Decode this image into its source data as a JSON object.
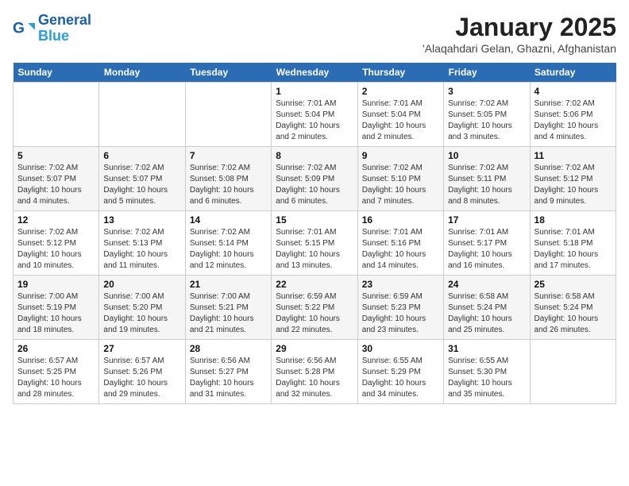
{
  "header": {
    "logo_line1": "General",
    "logo_line2": "Blue",
    "title": "January 2025",
    "subtitle": "'Alaqahdari Gelan, Ghazni, Afghanistan"
  },
  "days_of_week": [
    "Sunday",
    "Monday",
    "Tuesday",
    "Wednesday",
    "Thursday",
    "Friday",
    "Saturday"
  ],
  "weeks": [
    [
      {
        "num": "",
        "info": ""
      },
      {
        "num": "",
        "info": ""
      },
      {
        "num": "",
        "info": ""
      },
      {
        "num": "1",
        "info": "Sunrise: 7:01 AM\nSunset: 5:04 PM\nDaylight: 10 hours\nand 2 minutes."
      },
      {
        "num": "2",
        "info": "Sunrise: 7:01 AM\nSunset: 5:04 PM\nDaylight: 10 hours\nand 2 minutes."
      },
      {
        "num": "3",
        "info": "Sunrise: 7:02 AM\nSunset: 5:05 PM\nDaylight: 10 hours\nand 3 minutes."
      },
      {
        "num": "4",
        "info": "Sunrise: 7:02 AM\nSunset: 5:06 PM\nDaylight: 10 hours\nand 4 minutes."
      }
    ],
    [
      {
        "num": "5",
        "info": "Sunrise: 7:02 AM\nSunset: 5:07 PM\nDaylight: 10 hours\nand 4 minutes."
      },
      {
        "num": "6",
        "info": "Sunrise: 7:02 AM\nSunset: 5:07 PM\nDaylight: 10 hours\nand 5 minutes."
      },
      {
        "num": "7",
        "info": "Sunrise: 7:02 AM\nSunset: 5:08 PM\nDaylight: 10 hours\nand 6 minutes."
      },
      {
        "num": "8",
        "info": "Sunrise: 7:02 AM\nSunset: 5:09 PM\nDaylight: 10 hours\nand 6 minutes."
      },
      {
        "num": "9",
        "info": "Sunrise: 7:02 AM\nSunset: 5:10 PM\nDaylight: 10 hours\nand 7 minutes."
      },
      {
        "num": "10",
        "info": "Sunrise: 7:02 AM\nSunset: 5:11 PM\nDaylight: 10 hours\nand 8 minutes."
      },
      {
        "num": "11",
        "info": "Sunrise: 7:02 AM\nSunset: 5:12 PM\nDaylight: 10 hours\nand 9 minutes."
      }
    ],
    [
      {
        "num": "12",
        "info": "Sunrise: 7:02 AM\nSunset: 5:12 PM\nDaylight: 10 hours\nand 10 minutes."
      },
      {
        "num": "13",
        "info": "Sunrise: 7:02 AM\nSunset: 5:13 PM\nDaylight: 10 hours\nand 11 minutes."
      },
      {
        "num": "14",
        "info": "Sunrise: 7:02 AM\nSunset: 5:14 PM\nDaylight: 10 hours\nand 12 minutes."
      },
      {
        "num": "15",
        "info": "Sunrise: 7:01 AM\nSunset: 5:15 PM\nDaylight: 10 hours\nand 13 minutes."
      },
      {
        "num": "16",
        "info": "Sunrise: 7:01 AM\nSunset: 5:16 PM\nDaylight: 10 hours\nand 14 minutes."
      },
      {
        "num": "17",
        "info": "Sunrise: 7:01 AM\nSunset: 5:17 PM\nDaylight: 10 hours\nand 16 minutes."
      },
      {
        "num": "18",
        "info": "Sunrise: 7:01 AM\nSunset: 5:18 PM\nDaylight: 10 hours\nand 17 minutes."
      }
    ],
    [
      {
        "num": "19",
        "info": "Sunrise: 7:00 AM\nSunset: 5:19 PM\nDaylight: 10 hours\nand 18 minutes."
      },
      {
        "num": "20",
        "info": "Sunrise: 7:00 AM\nSunset: 5:20 PM\nDaylight: 10 hours\nand 19 minutes."
      },
      {
        "num": "21",
        "info": "Sunrise: 7:00 AM\nSunset: 5:21 PM\nDaylight: 10 hours\nand 21 minutes."
      },
      {
        "num": "22",
        "info": "Sunrise: 6:59 AM\nSunset: 5:22 PM\nDaylight: 10 hours\nand 22 minutes."
      },
      {
        "num": "23",
        "info": "Sunrise: 6:59 AM\nSunset: 5:23 PM\nDaylight: 10 hours\nand 23 minutes."
      },
      {
        "num": "24",
        "info": "Sunrise: 6:58 AM\nSunset: 5:24 PM\nDaylight: 10 hours\nand 25 minutes."
      },
      {
        "num": "25",
        "info": "Sunrise: 6:58 AM\nSunset: 5:24 PM\nDaylight: 10 hours\nand 26 minutes."
      }
    ],
    [
      {
        "num": "26",
        "info": "Sunrise: 6:57 AM\nSunset: 5:25 PM\nDaylight: 10 hours\nand 28 minutes."
      },
      {
        "num": "27",
        "info": "Sunrise: 6:57 AM\nSunset: 5:26 PM\nDaylight: 10 hours\nand 29 minutes."
      },
      {
        "num": "28",
        "info": "Sunrise: 6:56 AM\nSunset: 5:27 PM\nDaylight: 10 hours\nand 31 minutes."
      },
      {
        "num": "29",
        "info": "Sunrise: 6:56 AM\nSunset: 5:28 PM\nDaylight: 10 hours\nand 32 minutes."
      },
      {
        "num": "30",
        "info": "Sunrise: 6:55 AM\nSunset: 5:29 PM\nDaylight: 10 hours\nand 34 minutes."
      },
      {
        "num": "31",
        "info": "Sunrise: 6:55 AM\nSunset: 5:30 PM\nDaylight: 10 hours\nand 35 minutes."
      },
      {
        "num": "",
        "info": ""
      }
    ]
  ]
}
